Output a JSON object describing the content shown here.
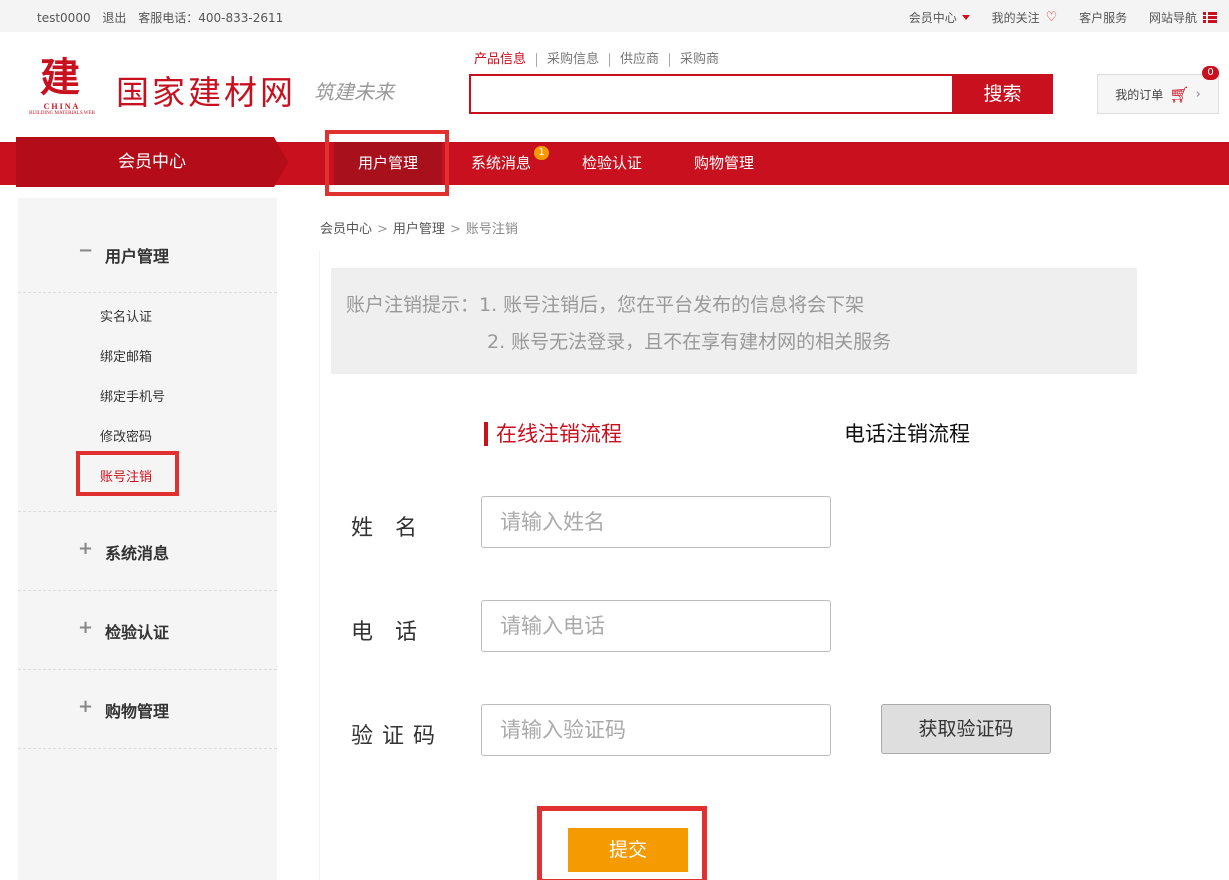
{
  "topbar": {
    "user": "test0000",
    "logout": "退出",
    "hotline": "客服电话：400-833-2611",
    "member_center": "会员中心",
    "my_follow": "我的关注",
    "customer_service": "客户服务",
    "site_nav": "网站导航"
  },
  "header": {
    "logo_sub1": "CHINA",
    "logo_sub2": "BUILDING MATERIALS WEB",
    "site_title": "国家建材网",
    "slogan": "筑建未来",
    "search_tabs": [
      "产品信息",
      "采购信息",
      "供应商",
      "采购商"
    ],
    "search_value": "",
    "search_button": "搜索",
    "my_orders": "我的订单",
    "order_count": "0"
  },
  "nav": {
    "member_center": "会员中心",
    "items": [
      "用户管理",
      "系统消息",
      "检验认证",
      "购物管理"
    ],
    "message_badge": "1"
  },
  "sidebar": {
    "groups": [
      {
        "sign": "−",
        "title": "用户管理",
        "items": [
          "实名认证",
          "绑定邮箱",
          "绑定手机号",
          "修改密码",
          "账号注销"
        ]
      },
      {
        "sign": "+",
        "title": "系统消息"
      },
      {
        "sign": "+",
        "title": "检验认证"
      },
      {
        "sign": "+",
        "title": "购物管理"
      }
    ]
  },
  "breadcrumb": [
    "会员中心",
    "用户管理",
    "账号注销"
  ],
  "breadcrumb_sep": ">",
  "notice": {
    "line1": "账户注销提示：1. 账号注销后，您在平台发布的信息将会下架",
    "line2": "2. 账号无法登录，且不在享有建材网的相关服务"
  },
  "process": {
    "online": "在线注销流程",
    "phone": "电话注销流程"
  },
  "form": {
    "name_label": "姓　名",
    "name_placeholder": "请输入姓名",
    "phone_label": "电　话",
    "phone_placeholder": "请输入电话",
    "code_label": "验证码",
    "code_placeholder": "请输入验证码",
    "get_code": "获取验证码",
    "submit": "提交"
  },
  "colors": {
    "brand": "#c8101f",
    "submit": "#f59a00",
    "highlight": "#e03030"
  }
}
